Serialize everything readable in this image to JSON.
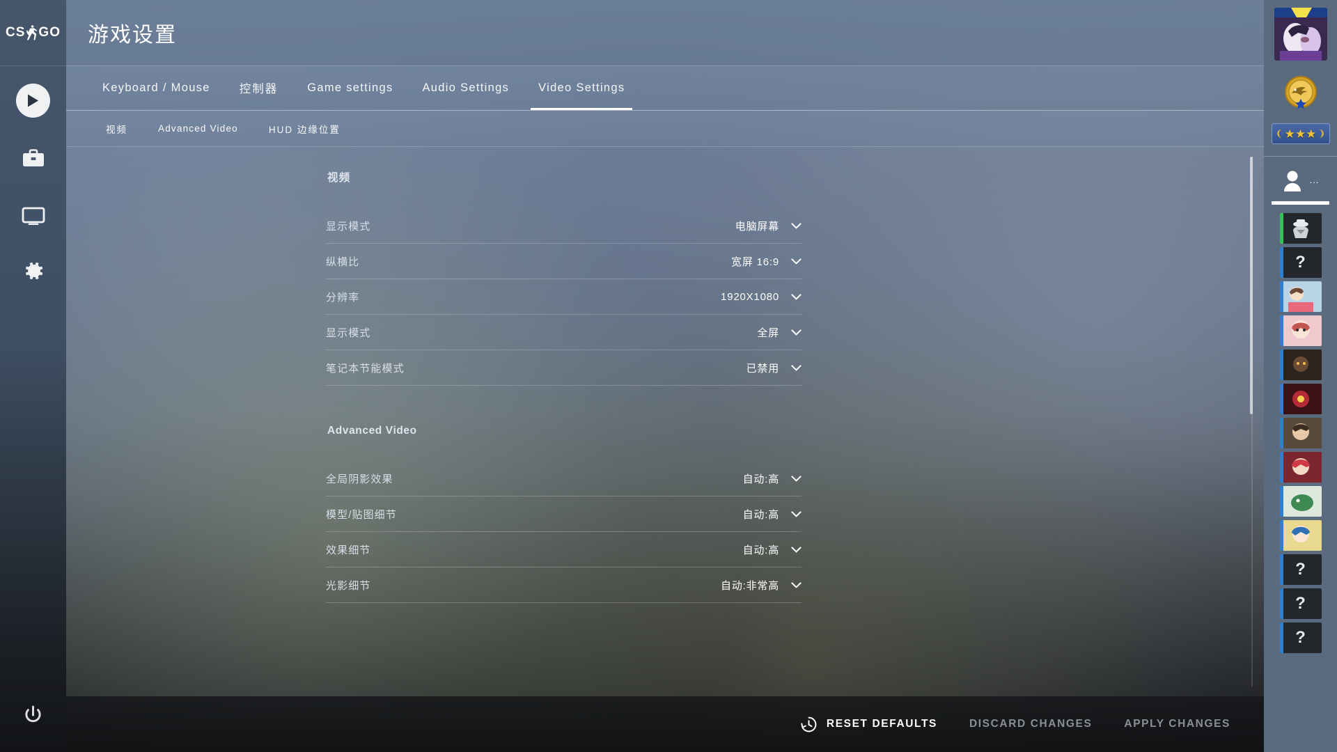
{
  "app": {
    "logo_text": "CS GO",
    "logo_icon": "csgo-player-icon"
  },
  "header": {
    "title": "游戏设置"
  },
  "nav": {
    "tabs": [
      {
        "label": "Keyboard / Mouse",
        "active": false
      },
      {
        "label": "控制器",
        "active": false
      },
      {
        "label": "Game settings",
        "active": false
      },
      {
        "label": "Audio Settings",
        "active": false
      },
      {
        "label": "Video Settings",
        "active": true
      }
    ],
    "subtabs": [
      {
        "label": "视频"
      },
      {
        "label": "Advanced Video"
      },
      {
        "label": "HUD 边缘位置"
      }
    ]
  },
  "rail": {
    "items": [
      {
        "name": "play-icon",
        "label": "Play"
      },
      {
        "name": "inventory-icon",
        "label": "Inventory"
      },
      {
        "name": "watch-icon",
        "label": "Watch"
      },
      {
        "name": "settings-gear-icon",
        "label": "Settings"
      }
    ],
    "power_label": "Quit"
  },
  "sections": [
    {
      "title": "视频",
      "rows": [
        {
          "label": "显示模式",
          "value": "电脑屏幕"
        },
        {
          "label": "纵横比",
          "value": "宽屏 16:9"
        },
        {
          "label": "分辨率",
          "value": "1920X1080"
        },
        {
          "label": "显示模式",
          "value": "全屏"
        },
        {
          "label": "笔记本节能模式",
          "value": "已禁用"
        }
      ]
    },
    {
      "title": "Advanced Video",
      "rows": [
        {
          "label": "全局阴影效果",
          "value": "自动:高"
        },
        {
          "label": "模型/贴图细节",
          "value": "自动:高"
        },
        {
          "label": "效果细节",
          "value": "自动:高"
        },
        {
          "label": "光影细节",
          "value": "自动:非常高"
        }
      ]
    }
  ],
  "actions": {
    "reset": {
      "label": "RESET DEFAULTS",
      "icon": "history-clock-icon",
      "enabled": true
    },
    "discard": {
      "label": "DISCARD CHANGES",
      "enabled": false
    },
    "apply": {
      "label": "APPLY CHANGES",
      "enabled": false
    }
  },
  "right_panel": {
    "avatar_name": "player-avatar",
    "medal_name": "eagle-coin-medal",
    "rank_name": "three-star-rank-badge",
    "rank_stars": "★★★",
    "friends_icon": "friends-person-icon",
    "friends_more": "...",
    "list": [
      {
        "icon": "agent-portrait",
        "edge": "#36c05a"
      },
      {
        "icon": "question-mark",
        "edge": "#2f7fd0",
        "glyph": "?"
      },
      {
        "icon": "anime-portrait-1",
        "edge": "#2f7fd0"
      },
      {
        "icon": "anime-portrait-2",
        "edge": "#2f7fd0"
      },
      {
        "icon": "dark-portrait",
        "edge": "#2f7fd0"
      },
      {
        "icon": "red-portrait",
        "edge": "#2f7fd0"
      },
      {
        "icon": "face-portrait",
        "edge": "#2f7fd0"
      },
      {
        "icon": "red-hair-portrait",
        "edge": "#2f7fd0"
      },
      {
        "icon": "green-portrait",
        "edge": "#2f7fd0"
      },
      {
        "icon": "blue-anime-portrait",
        "edge": "#2f7fd0"
      },
      {
        "icon": "question-mark",
        "edge": "#2f7fd0",
        "glyph": "?"
      },
      {
        "icon": "question-mark",
        "edge": "#2f7fd0",
        "glyph": "?"
      },
      {
        "icon": "question-mark",
        "edge": "#2f7fd0",
        "glyph": "?"
      }
    ]
  },
  "colors": {
    "accent": "#ffffff",
    "panel_blue": "#5d6e85",
    "bar_dark": "#16181b",
    "dim_text": "#8b8f93"
  }
}
